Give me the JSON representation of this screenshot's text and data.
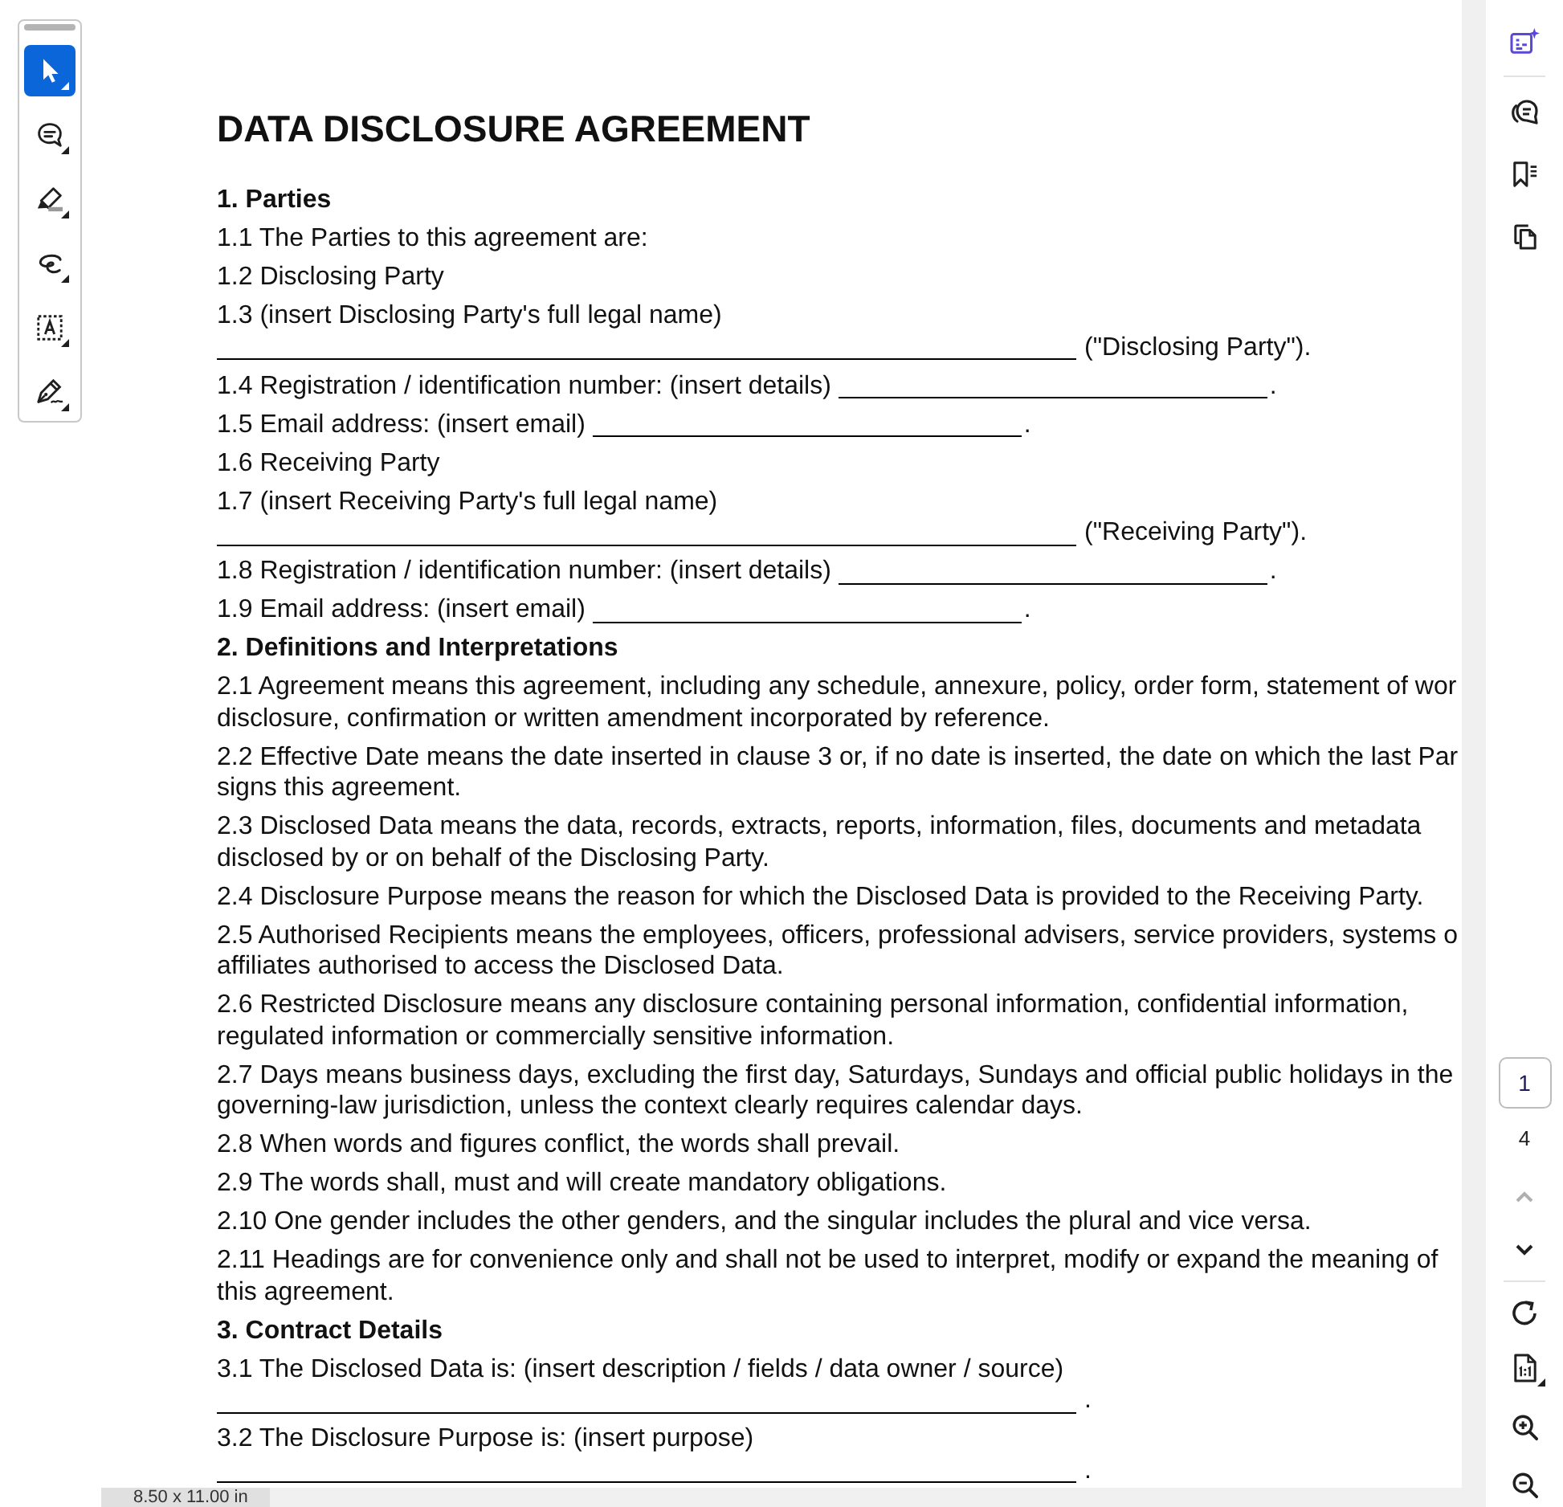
{
  "left_toolbar": {
    "tools": [
      {
        "kind": "select",
        "selected": true
      },
      {
        "kind": "comment",
        "selected": false
      },
      {
        "kind": "highlight",
        "selected": false
      },
      {
        "kind": "draw",
        "selected": false
      },
      {
        "kind": "text_box",
        "selected": false
      },
      {
        "kind": "sign",
        "selected": false
      }
    ]
  },
  "document": {
    "title": "DATA DISCLOSURE AGREEMENT",
    "blocks": [
      {
        "kind": "heading",
        "text": "1. Parties"
      },
      {
        "kind": "text",
        "lines": [
          "1.1 The Parties to this agreement are:"
        ]
      },
      {
        "kind": "text",
        "lines": [
          "1.2 Disclosing Party"
        ]
      },
      {
        "kind": "fill_in_below",
        "text": "1.3 (insert Disclosing Party's full legal name)",
        "after": "(\"Disclosing Party\")."
      },
      {
        "kind": "fill_in_inline",
        "text": "1.4 Registration / identification number: (insert details)",
        "after": "."
      },
      {
        "kind": "fill_in_inline",
        "text": "1.5 Email address: (insert email)",
        "after": "."
      },
      {
        "kind": "text",
        "lines": [
          "1.6 Receiving Party"
        ]
      },
      {
        "kind": "fill_in_below",
        "text": "1.7 (insert Receiving Party's full legal name)",
        "after": "(\"Receiving Party\")."
      },
      {
        "kind": "fill_in_inline",
        "text": "1.8 Registration / identification number: (insert details)",
        "after": "."
      },
      {
        "kind": "fill_in_inline",
        "text": "1.9 Email address: (insert email)",
        "after": "."
      },
      {
        "kind": "heading",
        "text": "2. Definitions and Interpretations"
      },
      {
        "kind": "text",
        "lines": [
          "2.1 Agreement means this agreement, including any schedule, annexure, policy, order form, statement of wor",
          "disclosure, confirmation or written amendment incorporated by reference."
        ]
      },
      {
        "kind": "text",
        "lines": [
          "2.2 Effective Date means the date inserted in clause 3 or, if no date is inserted, the date on which the last Par",
          "signs this agreement."
        ]
      },
      {
        "kind": "text",
        "lines": [
          "2.3 Disclosed Data means the data, records, extracts, reports, information, files, documents and metadata",
          "disclosed by or on behalf of the Disclosing Party."
        ]
      },
      {
        "kind": "text",
        "lines": [
          "2.4 Disclosure Purpose means the reason for which the Disclosed Data is provided to the Receiving Party."
        ]
      },
      {
        "kind": "text",
        "lines": [
          "2.5 Authorised Recipients means the employees, officers, professional advisers, service providers, systems o",
          "affiliates authorised to access the Disclosed Data."
        ]
      },
      {
        "kind": "text",
        "lines": [
          "2.6 Restricted Disclosure means any disclosure containing personal information, confidential information,",
          "regulated information or commercially sensitive information."
        ]
      },
      {
        "kind": "text",
        "lines": [
          "2.7 Days means business days, excluding the first day, Saturdays, Sundays and official public holidays in the",
          "governing-law jurisdiction, unless the context clearly requires calendar days."
        ]
      },
      {
        "kind": "text",
        "lines": [
          "2.8 When words and figures conflict, the words shall prevail."
        ]
      },
      {
        "kind": "text",
        "lines": [
          "2.9 The words shall, must and will create mandatory obligations."
        ]
      },
      {
        "kind": "text",
        "lines": [
          "2.10 One gender includes the other genders, and the singular includes the plural and vice versa."
        ]
      },
      {
        "kind": "text",
        "lines": [
          "2.11 Headings are for convenience only and shall not be used to interpret, modify or expand the meaning of",
          "this agreement."
        ]
      },
      {
        "kind": "heading",
        "text": "3. Contract Details"
      },
      {
        "kind": "fill_in_below",
        "text": "3.1 The Disclosed Data is: (insert description / fields / data owner / source)",
        "after": "."
      },
      {
        "kind": "fill_in_below",
        "text": "3.2 The Disclosure Purpose is: (insert purpose)",
        "after": "."
      }
    ]
  },
  "page_navigation": {
    "current_page": "1",
    "page_count": "4",
    "previous_disabled": true,
    "next_disabled": false
  },
  "status_bar": {
    "page_size": "8.50 x 11.00 in"
  }
}
